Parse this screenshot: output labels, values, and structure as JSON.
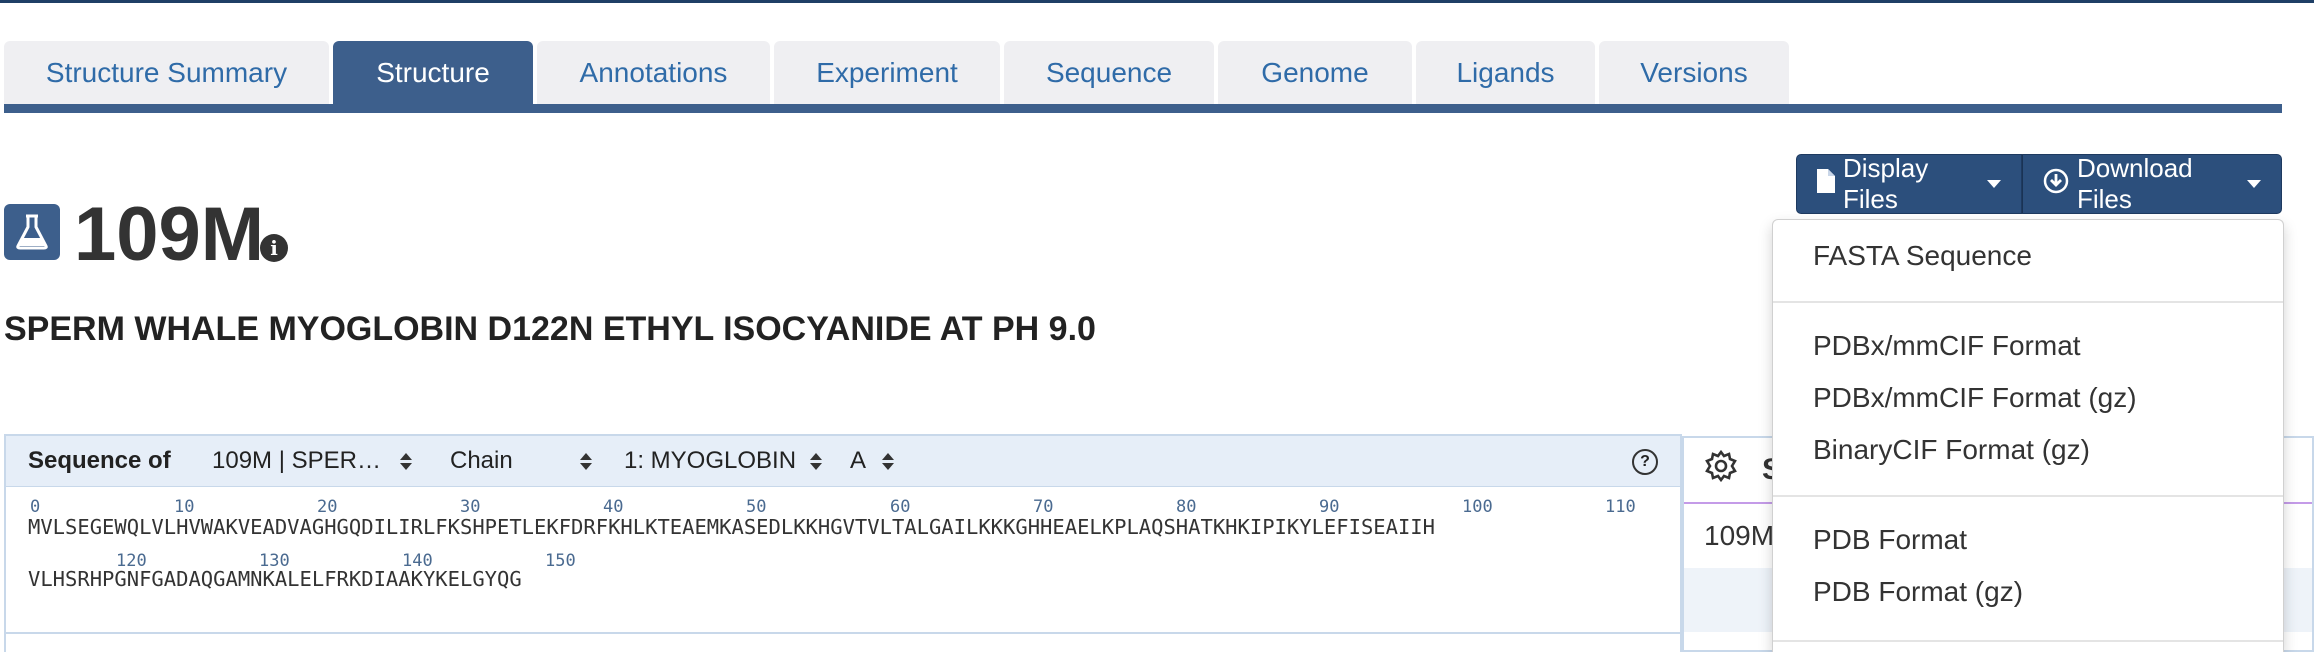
{
  "tabs": [
    "Structure Summary",
    "Structure",
    "Annotations",
    "Experiment",
    "Sequence",
    "Genome",
    "Ligands",
    "Versions"
  ],
  "active_tab": "Structure",
  "file_buttons": {
    "display": "Display Files",
    "download": "Download Files"
  },
  "entry": {
    "id": "109M",
    "title": "SPERM WHALE MYOGLOBIN D122N ETHYL ISOCYANIDE AT PH 9.0"
  },
  "sequence_viewer": {
    "label": "Sequence of",
    "entity_select": "109M | SPER…",
    "type_select": "Chain",
    "molecule_select": "1: MYOGLOBIN",
    "chain_select": "A",
    "ruler_line1": [
      "0",
      "10",
      "20",
      "30",
      "40",
      "50",
      "60",
      "70",
      "80",
      "90",
      "100",
      "110"
    ],
    "sequence_line1": "MVLSEGEWQLVLHVWAKVEADVAGHGQDILIRLFKSHPETLEKFDRFKHLKTEAEMKASEDLKKHGVTVLTALGAILKKKGHHEAELKPLAQSHATKHKIPIKYLEFISEAIIH",
    "ruler_line2": [
      "120",
      "130",
      "140",
      "150"
    ],
    "sequence_line2": "VLHSRHPGNFGADAQGAMNKALELFRKDIAAKYKELGYQG"
  },
  "side_panel": {
    "header_text": "S",
    "row_text": "109M"
  },
  "download_menu": {
    "groups": [
      [
        "FASTA Sequence"
      ],
      [
        "PDBx/mmCIF Format",
        "PDBx/mmCIF Format (gz)",
        "BinaryCIF Format (gz)"
      ],
      [
        "PDB Format",
        "PDB Format (gz)"
      ]
    ]
  },
  "colors": {
    "brand_navy": "#3d5f8c",
    "button_navy": "#2c4f7c",
    "tab_text_blue": "#2f6ba8",
    "tab_bg": "#efeff2",
    "panel_border": "#c8d8ea"
  },
  "icons": [
    "flask-icon",
    "info-icon",
    "file-icon",
    "download-circle-icon",
    "caret-down-icon",
    "help-circle-icon",
    "gear-icon",
    "select-arrows-icon"
  ]
}
